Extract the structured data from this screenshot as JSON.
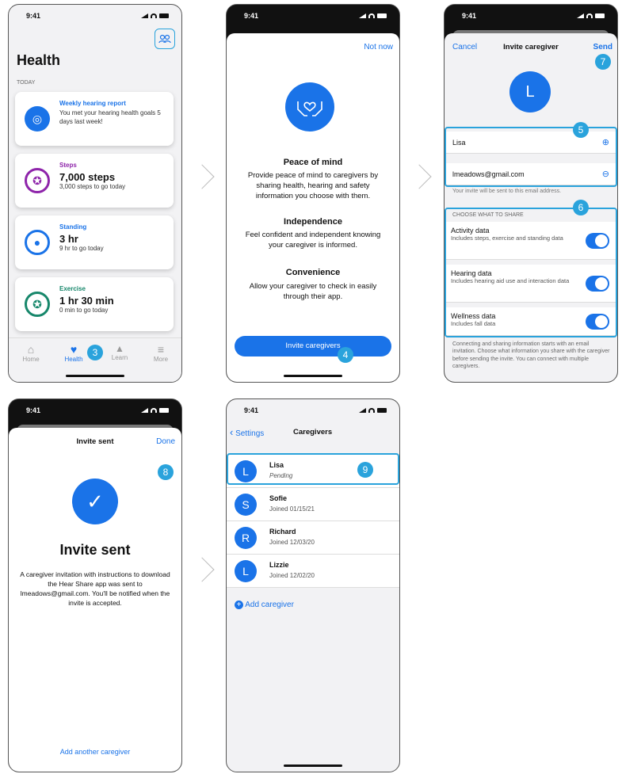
{
  "status_time": "9:41",
  "s1": {
    "title": "Health",
    "section": "TODAY",
    "cards": [
      {
        "kicker": "Weekly hearing report",
        "big": "",
        "sub": "You met your hearing health goals 5 days last week!",
        "color": "#1a73e8",
        "icon": "ear-icon"
      },
      {
        "kicker": "Steps",
        "big": "7,000 steps",
        "sub": "3,000 steps to go today",
        "color": "#8e24aa",
        "icon": "walking-icon"
      },
      {
        "kicker": "Standing",
        "big": "3 hr",
        "sub": "9 hr to go today",
        "color": "#1a73e8",
        "icon": "standing-icon"
      },
      {
        "kicker": "Exercise",
        "big": "1 hr 30 min",
        "sub": "0 min to go today",
        "color": "#17876b",
        "icon": "exercise-icon"
      }
    ],
    "tabs": [
      {
        "label": "Home",
        "glyph": "⌂"
      },
      {
        "label": "Health",
        "glyph": "♥"
      },
      {
        "label": "Learn",
        "glyph": "▲"
      },
      {
        "label": "More",
        "glyph": "≡"
      }
    ],
    "badge": "3"
  },
  "s2": {
    "not_now": "Not now",
    "h1": "Peace of mind",
    "p1": "Provide peace of mind to caregivers by sharing health, hearing and safety information you choose with them.",
    "h2": "Independence",
    "p2": "Feel confident and independent knowing your caregiver is informed.",
    "h3": "Convenience",
    "p3": "Allow your caregiver to check in easily through their app.",
    "button": "Invite caregivers",
    "badge": "4"
  },
  "s3": {
    "cancel": "Cancel",
    "title": "Invite caregiver",
    "send": "Send",
    "avatar": "L",
    "name_value": "Lisa",
    "email_value": "lmeadows@gmail.com",
    "email_note": "Your invite will be sent to this email address.",
    "share_header": "CHOOSE WHAT TO SHARE",
    "shares": [
      {
        "title": "Activity data",
        "desc": "Includes steps, exercise and standing data"
      },
      {
        "title": "Hearing data",
        "desc": "Includes hearing aid use and interaction data"
      },
      {
        "title": "Wellness data",
        "desc": "Includes fall data"
      }
    ],
    "footer": "Connecting and sharing information starts with an email invitation. Choose what information you share with the caregiver before sending the invite. You can connect with multiple caregivers.",
    "badges": {
      "b5": "5",
      "b6": "6",
      "b7": "7"
    }
  },
  "s4": {
    "title": "Invite sent",
    "done": "Done",
    "heading": "Invite sent",
    "body": "A caregiver invitation with instructions to download the Hear Share app was sent to lmeadows@gmail.com. You'll be notified when the invite is accepted.",
    "add_another": "Add another caregiver",
    "badge": "8"
  },
  "s5": {
    "back": "Settings",
    "title": "Caregivers",
    "caregivers": [
      {
        "initial": "L",
        "name": "Lisa",
        "sub": "Pending"
      },
      {
        "initial": "S",
        "name": "Sofie",
        "sub": "Joined 01/15/21"
      },
      {
        "initial": "R",
        "name": "Richard",
        "sub": "Joined 12/03/20"
      },
      {
        "initial": "L",
        "name": "Lizzie",
        "sub": "Joined 12/02/20"
      }
    ],
    "add": "Add caregiver",
    "badge": "9"
  }
}
